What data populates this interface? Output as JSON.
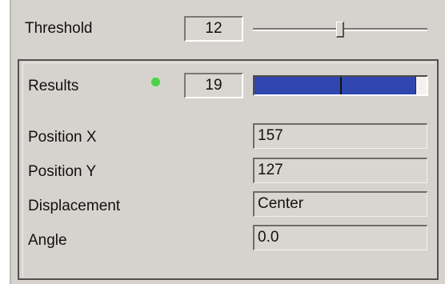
{
  "threshold": {
    "label": "Threshold",
    "value": "12",
    "slider_level": 0.5
  },
  "results": {
    "label": "Results",
    "value": "19",
    "status_color": "#4bd24b",
    "progress_level": 0.94,
    "progress_marker_level": 0.5,
    "progress_color": "#2f46b0"
  },
  "fields": [
    {
      "label": "Position X",
      "value": "157"
    },
    {
      "label": "Position Y",
      "value": "127"
    },
    {
      "label": "Displacement",
      "value": "Center"
    },
    {
      "label": "Angle",
      "value": "0.0"
    }
  ]
}
